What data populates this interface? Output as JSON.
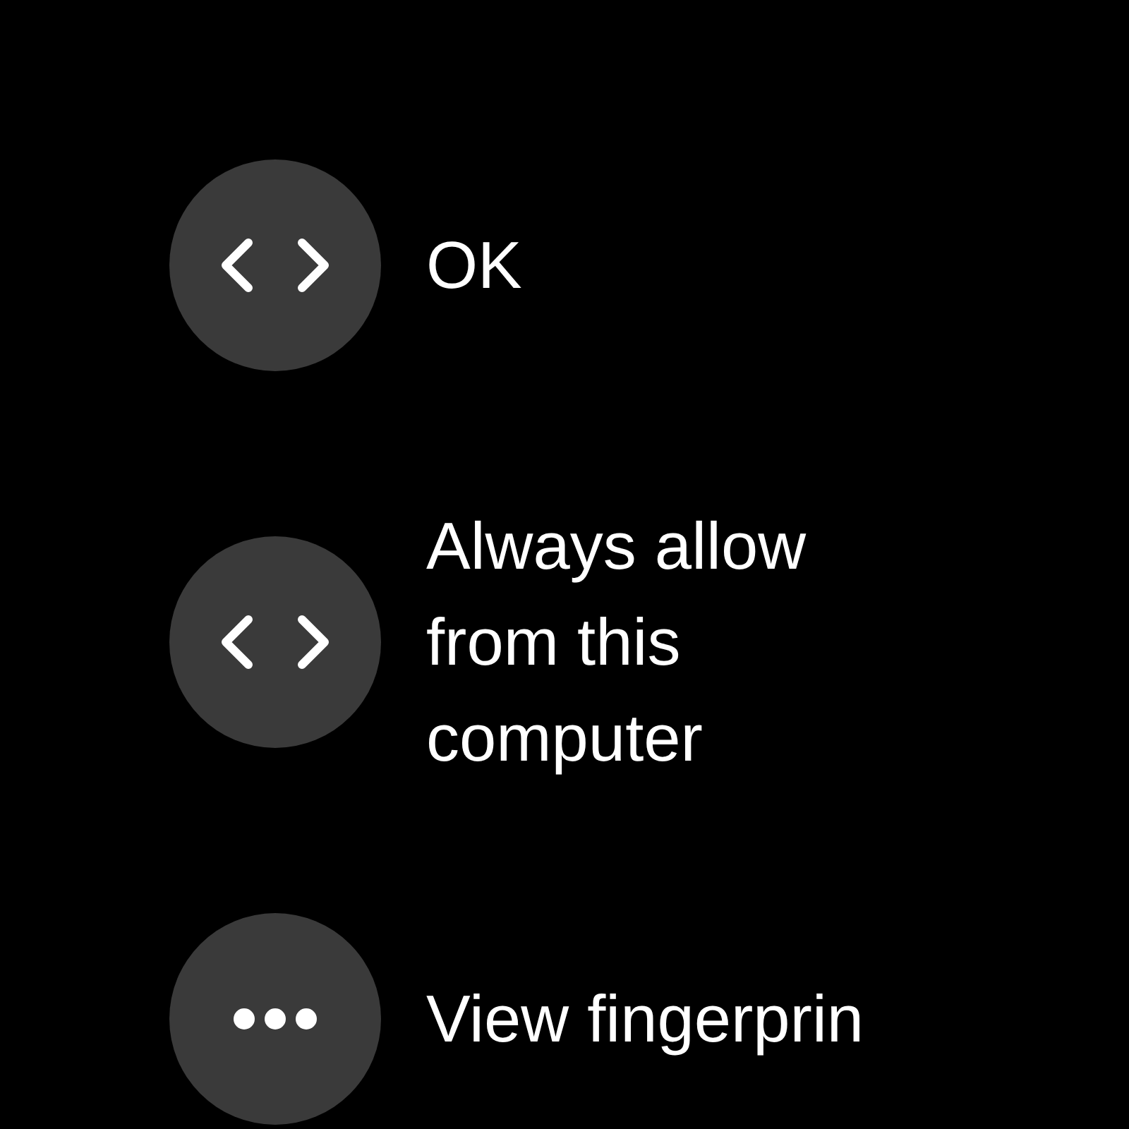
{
  "options": [
    {
      "kind": "code",
      "label": "OK"
    },
    {
      "kind": "code",
      "label": "Always allow from this computer"
    },
    {
      "kind": "more",
      "label": "View fingerprin"
    }
  ]
}
